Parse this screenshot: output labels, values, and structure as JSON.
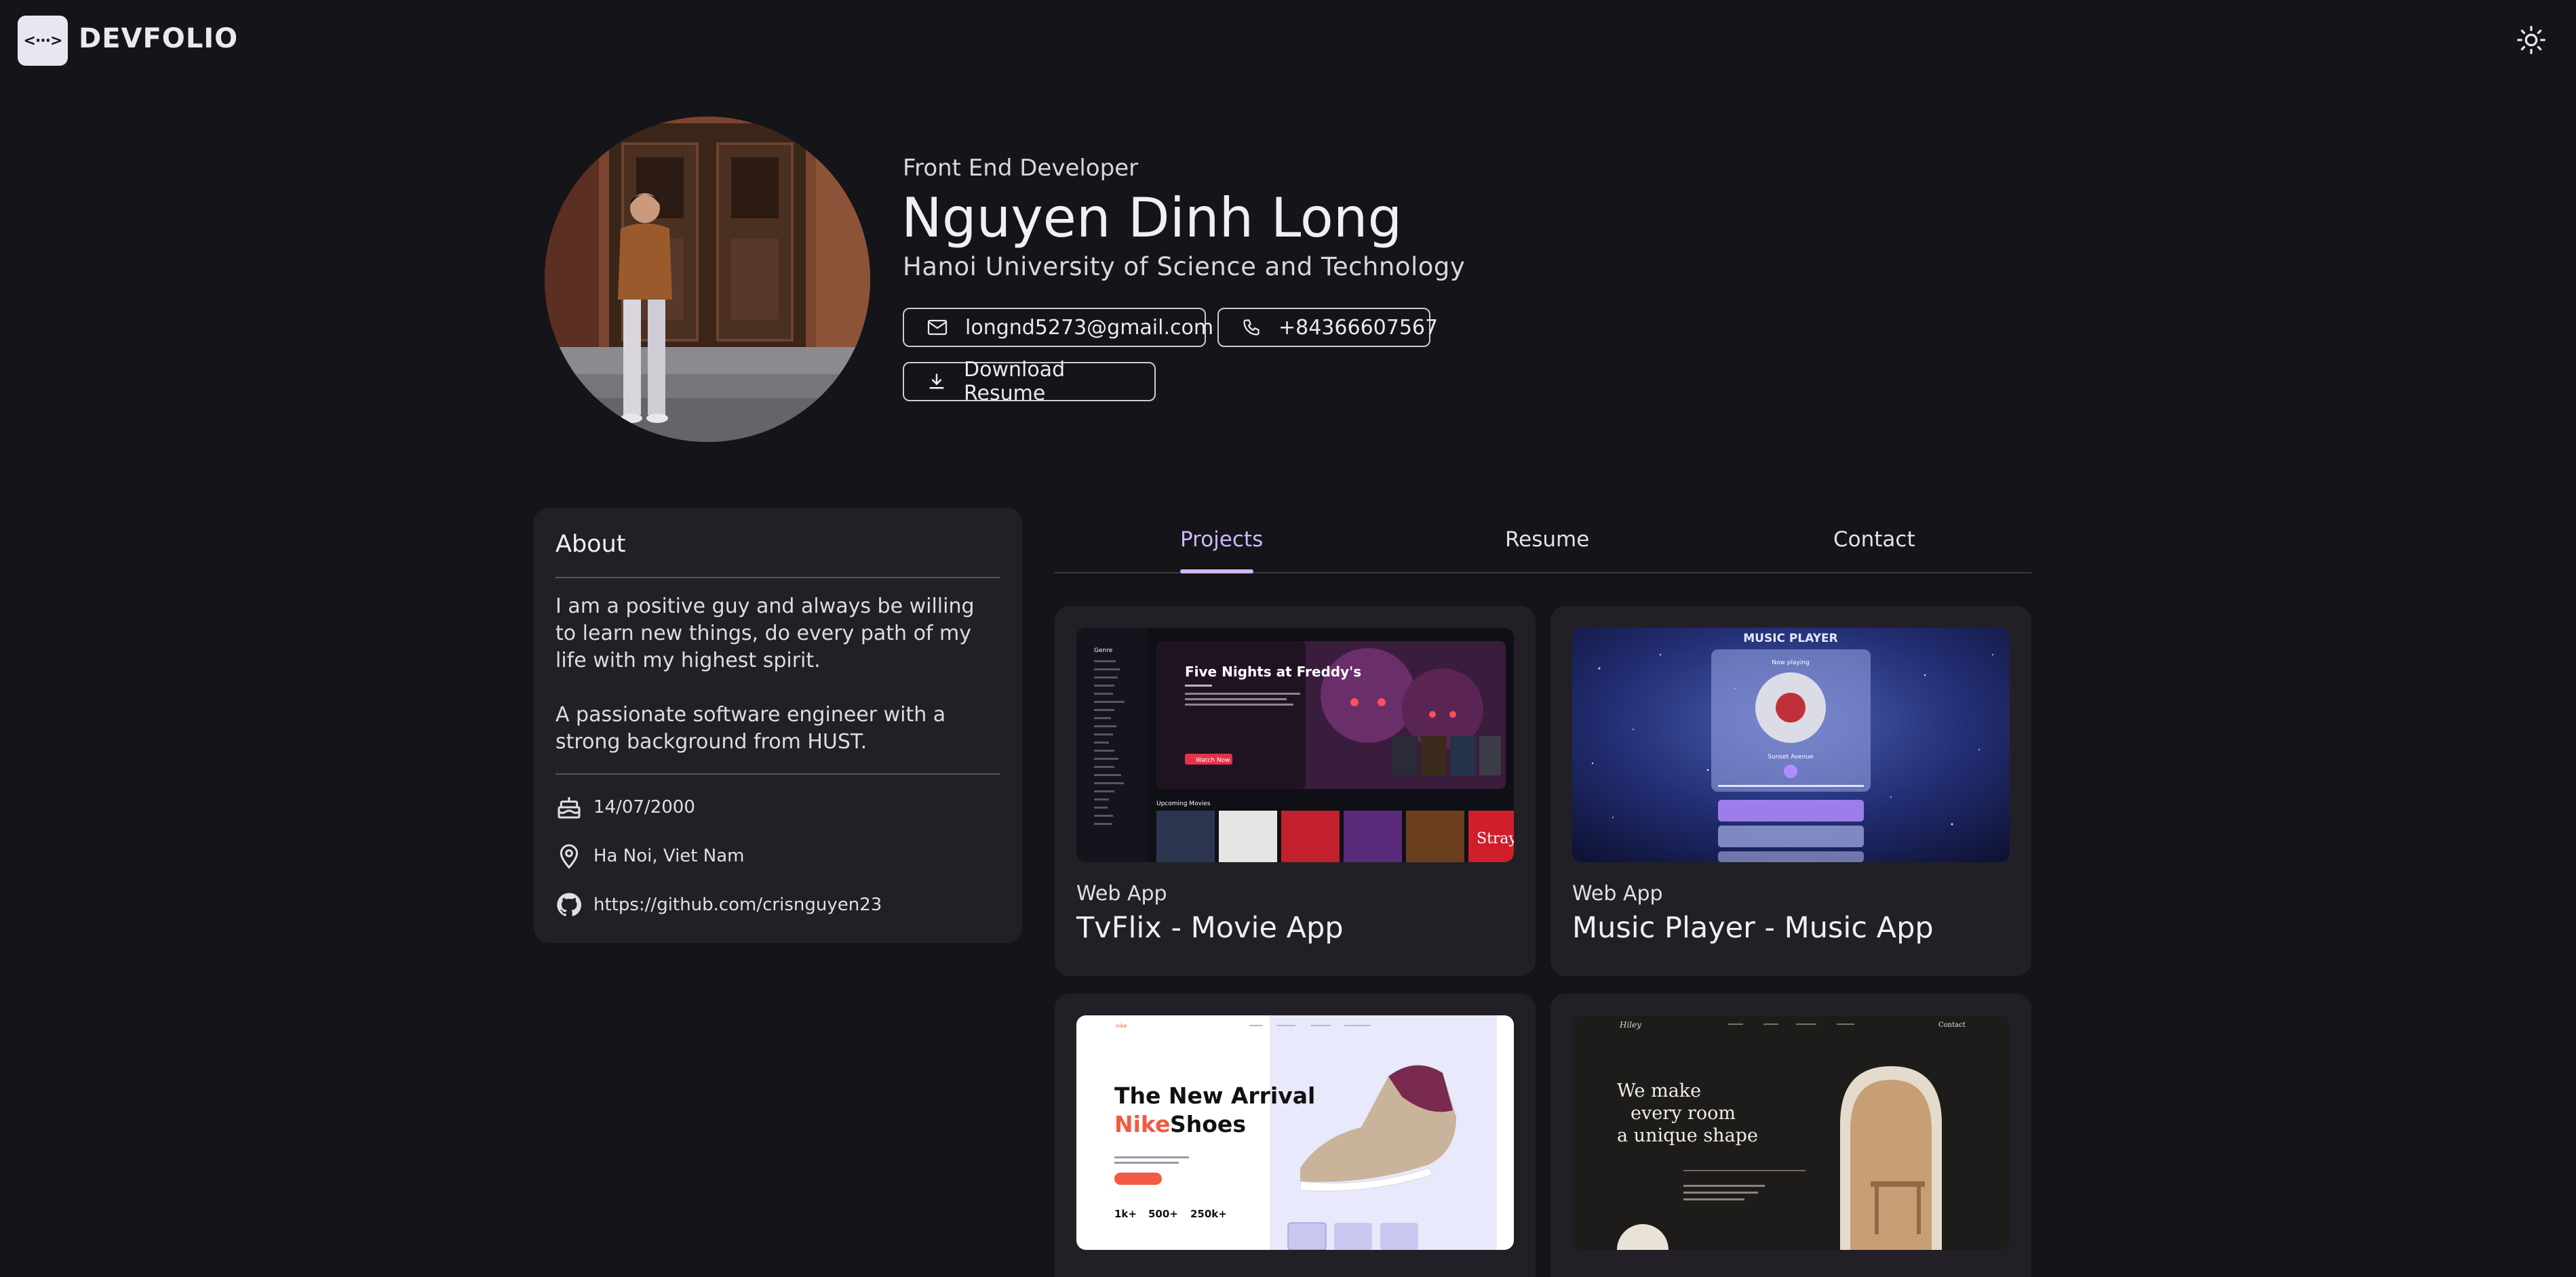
{
  "brand": {
    "logo_glyph": "<···>",
    "name": "DEVFOLIO"
  },
  "theme_toggle": {
    "icon": "sun-icon"
  },
  "profile": {
    "subtitle": "Front End Developer",
    "name": "Nguyen Dinh Long",
    "school": "Hanoi University of Science and Technology",
    "email": "longnd5273@gmail.com",
    "phone": "+84366607567",
    "download_label": "Download Resume"
  },
  "about": {
    "title": "About",
    "paragraph1": "I am a positive guy and always be willing to learn new things, do every path of my life with my highest spirit.",
    "paragraph2": "A passionate software engineer with a strong background from HUST.",
    "birthday": "14/07/2000",
    "location": "Ha Noi, Viet Nam",
    "github": "https://github.com/crisnguyen23"
  },
  "tabs": [
    {
      "label": "Projects",
      "active": true
    },
    {
      "label": "Resume",
      "active": false
    },
    {
      "label": "Contact",
      "active": false
    }
  ],
  "projects": [
    {
      "kind": "Web App",
      "title": "TvFlix - Movie App",
      "shot": {
        "hero_title": "Five Nights at Freddy's",
        "cta": "Watch Now",
        "sidebar_heading": "Genre",
        "section_label": "Upcoming Movies",
        "poster_text": "Stray"
      }
    },
    {
      "kind": "Web App",
      "title": "Music Player - Music App",
      "shot": {
        "header": "MUSIC PLAYER",
        "now_playing": "Now playing",
        "track": "Sunset Avenue"
      }
    },
    {
      "kind": "",
      "title": "",
      "shot": {
        "headline_1": "The New Arrival",
        "headline_2a": "Nike",
        "headline_2b": "Shoes",
        "stats": [
          "1k+",
          "500+",
          "250k+"
        ],
        "brand": "nike"
      }
    },
    {
      "kind": "",
      "title": "",
      "shot": {
        "headline": "We make every room a unique shape",
        "nav_link": "Contact",
        "brand": "Hiley"
      }
    }
  ],
  "colors": {
    "background": "#151418",
    "card": "#222026",
    "accent": "#cdb8ff",
    "nike_accent": "#f25a43"
  }
}
